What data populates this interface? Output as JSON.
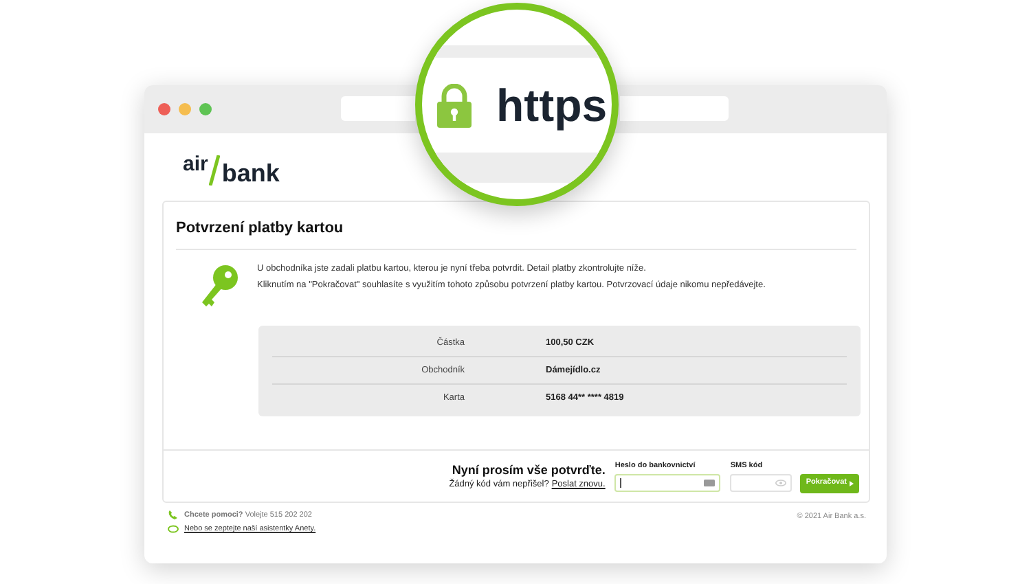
{
  "magnifier": {
    "text": "https"
  },
  "logo": {
    "left": "air",
    "right": "bank"
  },
  "card": {
    "title": "Potvrzení platby kartou",
    "paragraphs": [
      "U obchodníka jste zadali platbu kartou, kterou je nyní třeba potvrdit. Detail platby zkontrolujte níže.",
      "Kliknutím na \"Pokračovat\" souhlasíte s využitím tohoto způsobu potvrzení platby kartou. Potvrzovací údaje nikomu nepředávejte."
    ],
    "details": [
      {
        "label": "Částka",
        "value": "100,50 CZK"
      },
      {
        "label": "Obchodník",
        "value": "Dámejídlo.cz"
      },
      {
        "label": "Karta",
        "value": "5168 44** **** 4819"
      }
    ],
    "confirm": {
      "heading": "Nyní prosím vše potvrďte.",
      "prompt": "Žádný kód vám nepřišel?",
      "link": "Poslat znovu."
    },
    "fields": [
      {
        "label": "Heslo do bankovnictví",
        "kind": "password",
        "focused": true
      },
      {
        "label": "SMS kód",
        "kind": "sms",
        "focused": false
      }
    ],
    "button": "Pokračovat"
  },
  "footer": {
    "help": "Chcete pomoci?",
    "phone": "Volejte 515 202 202",
    "chat": "Nebo se zeptejte naší asistentky Anety.",
    "copyright": "© 2021 Air Bank a.s."
  }
}
